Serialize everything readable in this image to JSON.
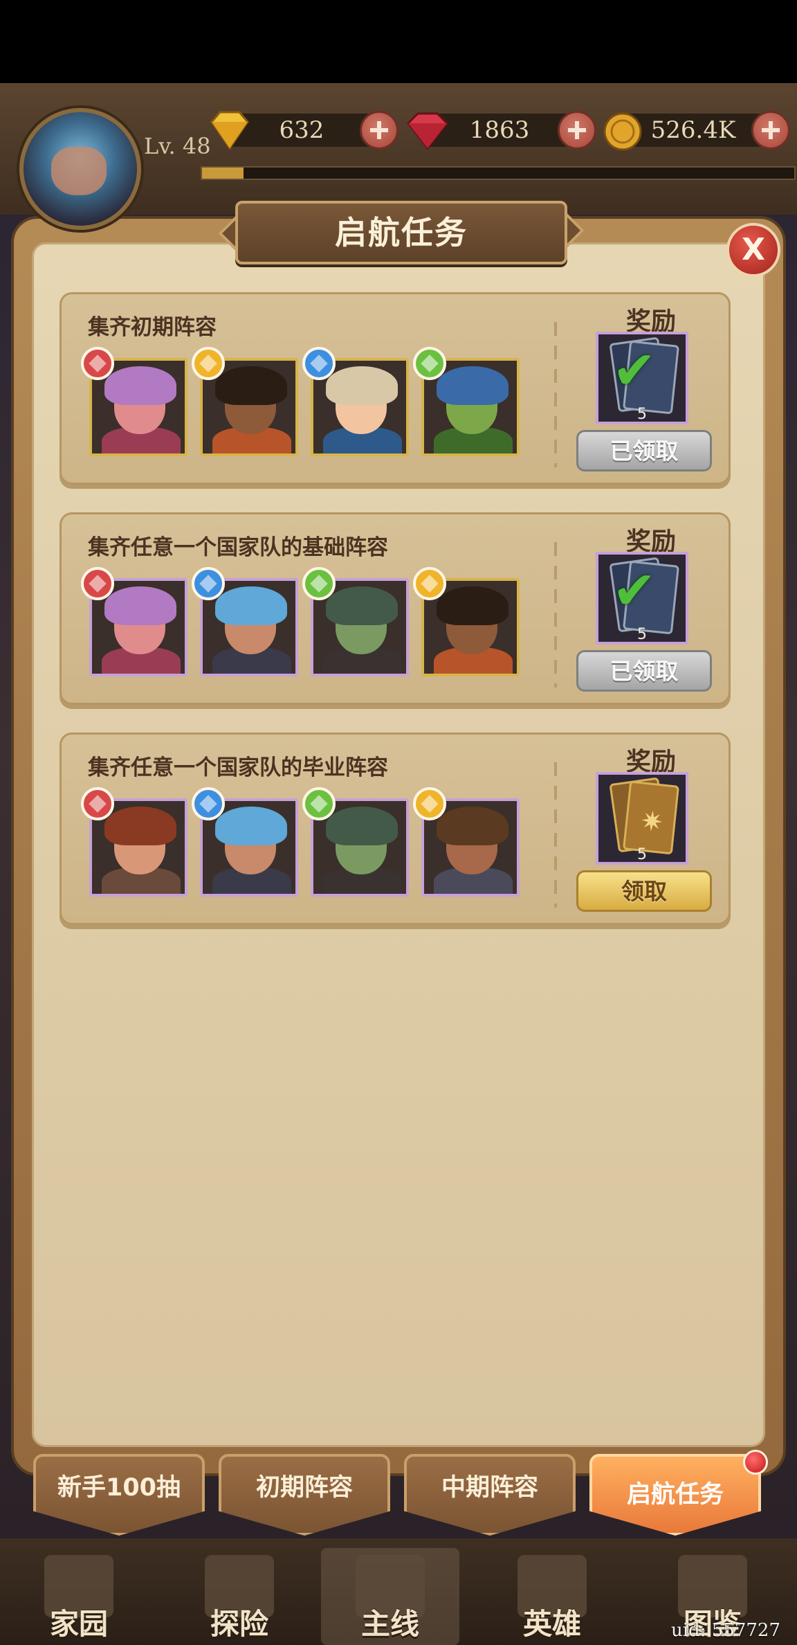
{
  "hud": {
    "level": "Lv. 48",
    "xp_fraction": 0.07,
    "resources": [
      {
        "name": "gold-gem",
        "value": "632",
        "color": "#f0c23a"
      },
      {
        "name": "ruby",
        "value": "1863",
        "color": "#d63a4a"
      },
      {
        "name": "coin",
        "value": "526.4K",
        "color": "#e2a52c"
      }
    ]
  },
  "panel": {
    "title": "启航任务",
    "close_label": "X"
  },
  "tasks": [
    {
      "title": "集齐初期阵容",
      "reward_label": "奖励",
      "reward_qty": "5",
      "button": "已领取",
      "heroes": [
        {
          "element": "fire",
          "element_color": "#d84848",
          "hair": "#b27ac2",
          "face": "#e08c8c",
          "body": "#9a3d54",
          "frame": "gold"
        },
        {
          "element": "light",
          "element_color": "#f0b42a",
          "hair": "#2a1d14",
          "face": "#8d5a3a",
          "body": "#b8542a",
          "frame": "gold"
        },
        {
          "element": "water",
          "element_color": "#3d8fe0",
          "hair": "#d8c8a8",
          "face": "#f2c4a0",
          "body": "#2d5a8a",
          "frame": "gold"
        },
        {
          "element": "nature",
          "element_color": "#6cc040",
          "hair": "#3a6aa8",
          "face": "#7ca84a",
          "body": "#3f6b2a",
          "frame": "gold"
        }
      ]
    },
    {
      "title": "集齐任意一个国家队的基础阵容",
      "reward_label": "奖励",
      "reward_qty": "5",
      "button": "已领取",
      "heroes": [
        {
          "element": "fire",
          "element_color": "#d84848",
          "hair": "#b27ac2",
          "face": "#e08c8c",
          "body": "#9a3d54",
          "frame": "purple"
        },
        {
          "element": "water",
          "element_color": "#3d8fe0",
          "hair": "#5fa8d8",
          "face": "#c88a6a",
          "body": "#3a3a4a",
          "frame": "purple"
        },
        {
          "element": "nature",
          "element_color": "#6cc040",
          "hair": "#445a48",
          "face": "#7a9a62",
          "body": "#3a3230",
          "frame": "purple"
        },
        {
          "element": "light",
          "element_color": "#f0b42a",
          "hair": "#2a1d14",
          "face": "#8d5a3a",
          "body": "#b8542a",
          "frame": "gold"
        }
      ]
    },
    {
      "title": "集齐任意一个国家队的毕业阵容",
      "reward_label": "奖励",
      "reward_qty": "5",
      "button": "领取",
      "heroes": [
        {
          "element": "fire",
          "element_color": "#d84848",
          "hair": "#8a3a22",
          "face": "#d89878",
          "body": "#6a4a3a",
          "frame": "purple"
        },
        {
          "element": "water",
          "element_color": "#3d8fe0",
          "hair": "#5fa8d8",
          "face": "#c88a6a",
          "body": "#3a3a4a",
          "frame": "purple"
        },
        {
          "element": "nature",
          "element_color": "#6cc040",
          "hair": "#445a48",
          "face": "#7a9a62",
          "body": "#3a3230",
          "frame": "purple"
        },
        {
          "element": "light",
          "element_color": "#f0b42a",
          "hair": "#5a3a20",
          "face": "#a8684a",
          "body": "#4a4a5a",
          "frame": "purple"
        }
      ]
    }
  ],
  "tabs": [
    {
      "label": "新手100抽",
      "active": false
    },
    {
      "label": "初期阵容",
      "active": false
    },
    {
      "label": "中期阵容",
      "active": false
    },
    {
      "label": "启航任务",
      "active": true
    }
  ],
  "nav": [
    {
      "label": "家园",
      "active": false
    },
    {
      "label": "探险",
      "active": false
    },
    {
      "label": "主线",
      "active": true
    },
    {
      "label": "英雄",
      "active": false
    },
    {
      "label": "图鉴",
      "active": false
    }
  ],
  "uid": "uid: 557727"
}
